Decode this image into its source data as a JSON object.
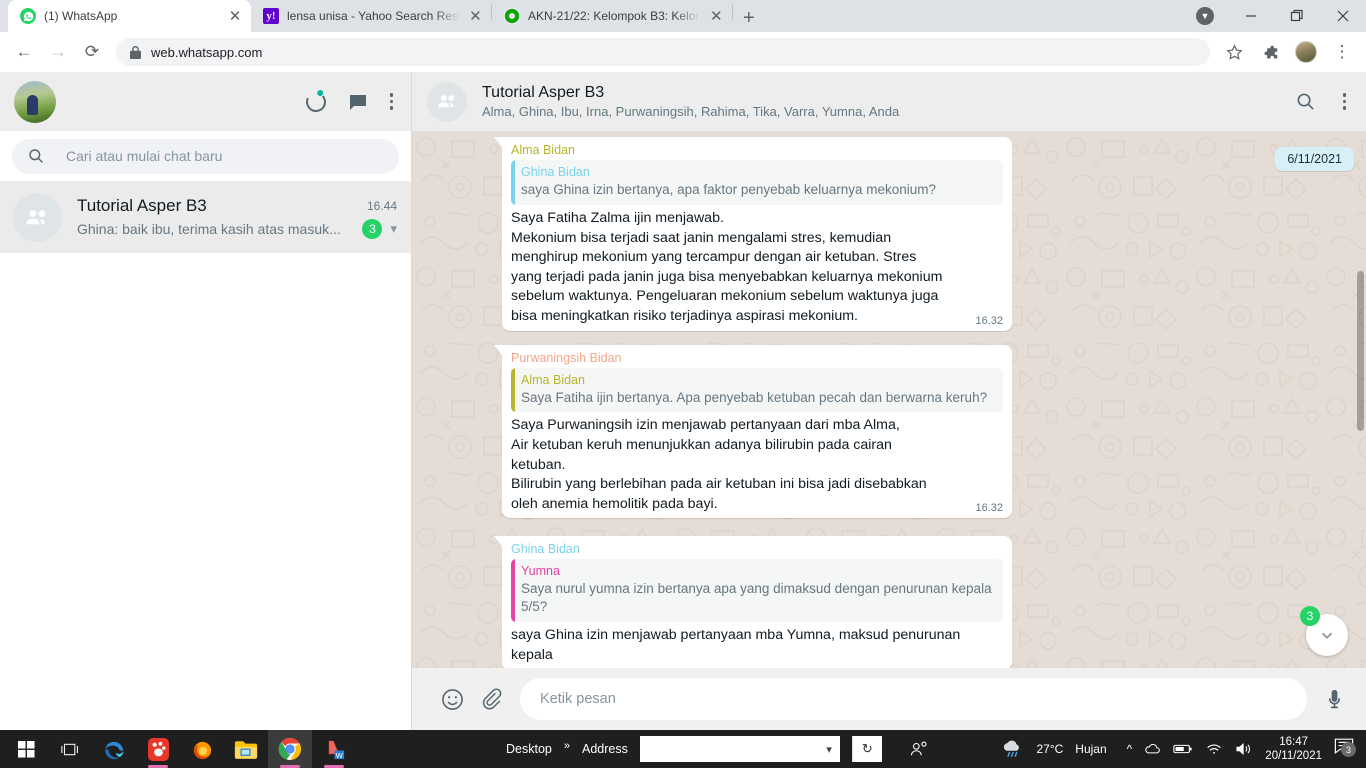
{
  "browser": {
    "tabs": [
      {
        "title": "(1) WhatsApp",
        "favicon": "whatsapp-icon",
        "active": true
      },
      {
        "title": "lensa unisa - Yahoo Search Result",
        "favicon": "yahoo-icon",
        "active": false
      },
      {
        "title": "AKN-21/22: Kelompok B3: Kelom",
        "favicon": "moodle-icon",
        "active": false
      }
    ],
    "new_tab_label": "+",
    "window_controls": {
      "minimize": "—",
      "maximize": "❐",
      "close": "✕"
    },
    "toolbar": {
      "back": "←",
      "forward": "→",
      "reload": "⟳",
      "lock_icon": "lock-icon",
      "url": "web.whatsapp.com",
      "bookmark": "☆",
      "extensions": "puzzle-icon",
      "profile": "avatar",
      "menu": "⋮"
    }
  },
  "sidebar": {
    "profile_avatar": "user-avatar",
    "icons": {
      "status": "status-ring-icon",
      "new_chat": "new-chat-icon",
      "menu": "menu-icon"
    },
    "search": {
      "placeholder": "Cari atau mulai chat baru",
      "icon": "search-icon"
    },
    "chats": [
      {
        "name": "Tutorial Asper B3",
        "time": "16.44",
        "preview": "Ghina: baik ibu, terima kasih atas masuk...",
        "unread": "3",
        "avatar": "group-avatar"
      }
    ]
  },
  "chat": {
    "title": "Tutorial Asper B3",
    "participants": "Alma, Ghina, Ibu, Irna, Purwaningsih, Rahima, Tika, Varra, Yumna, Anda",
    "avatar": "group-avatar",
    "search_icon": "search-icon",
    "menu_icon": "menu-icon",
    "date_pill": "6/11/2021",
    "scroll_down": {
      "icon": "chevron-down-icon",
      "unread": "3"
    },
    "messages": [
      {
        "sender": "Alma Bidan",
        "sender_color": "#b8b52b",
        "sender_class": "c-olive",
        "quote": {
          "name": "Ghina Bidan",
          "name_class": "c-blue",
          "bar_class": "q-blue",
          "text": "saya Ghina izin bertanya, apa faktor penyebab keluarnya mekonium?"
        },
        "text": "Saya Fatiha Zalma ijin menjawab.\nMekonium bisa terjadi saat janin mengalami stres, kemudian menghirup mekonium yang tercampur dengan air ketuban. Stres yang terjadi pada janin juga bisa menyebabkan keluarnya mekonium sebelum waktunya. Pengeluaran mekonium sebelum waktunya juga bisa meningkatkan risiko terjadinya aspirasi mekonium.",
        "time": "16.32"
      },
      {
        "sender": "Purwaningsih Bidan",
        "sender_color": "#f4a58a",
        "sender_class": "c-peach",
        "quote": {
          "name": "Alma Bidan",
          "name_class": "c-olive",
          "bar_class": "q-olive",
          "text": "Saya Fatiha ijin bertanya. Apa penyebab ketuban pecah dan berwarna keruh?"
        },
        "text": "Saya Purwaningsih izin menjawab pertanyaan dari mba Alma,\nAir ketuban keruh menunjukkan adanya bilirubin pada cairan ketuban.\nBilirubin yang berlebihan pada air ketuban ini bisa jadi disebabkan oleh anemia hemolitik pada bayi.",
        "time": "16.32"
      },
      {
        "sender": "Ghina Bidan",
        "sender_color": "#79d3ec",
        "sender_class": "c-blue",
        "quote": {
          "name": "Yumna",
          "name_class": "c-pink",
          "bar_class": "q-pink",
          "text": "Saya nurul yumna izin bertanya apa yang dimaksud dengan penurunan kepala 5/5?"
        },
        "text": "saya Ghina izin menjawab pertanyaan mba Yumna, maksud penurunan kepala",
        "time": ""
      }
    ],
    "composer": {
      "emoji_icon": "emoji-icon",
      "attach_icon": "attach-icon",
      "placeholder": "Ketik pesan",
      "mic_icon": "microphone-icon"
    }
  },
  "taskbar": {
    "start": "windows-start-icon",
    "task_view": "task-view-icon",
    "apps": [
      "edge-icon",
      "gnome-icon",
      "firefox-icon",
      "file-explorer-icon",
      "chrome-icon",
      "vlc-icon"
    ],
    "desktop_label": "Desktop",
    "chevrons": "»",
    "address_label": "Address",
    "address_value": "",
    "address_dropdown": "chevron-down-icon",
    "address_refresh": "↻",
    "people_icon": "people-icon",
    "weather": {
      "icon": "weather-icon",
      "temperature": "27°C",
      "condition": "Hujan"
    },
    "tray": {
      "show_hidden": "^",
      "onedrive": "onedrive-icon",
      "battery": "battery-icon",
      "network": "wifi-icon",
      "volume": "volume-icon"
    },
    "clock": {
      "time": "16:47",
      "date": "20/11/2021"
    },
    "notifications": {
      "icon": "notification-icon",
      "count": "3"
    }
  },
  "colors": {
    "whatsapp_green": "#25d366",
    "chat_bg": "#e5ddd5",
    "header_bg": "#ededed",
    "date_pill_bg": "#d7f0f7"
  }
}
